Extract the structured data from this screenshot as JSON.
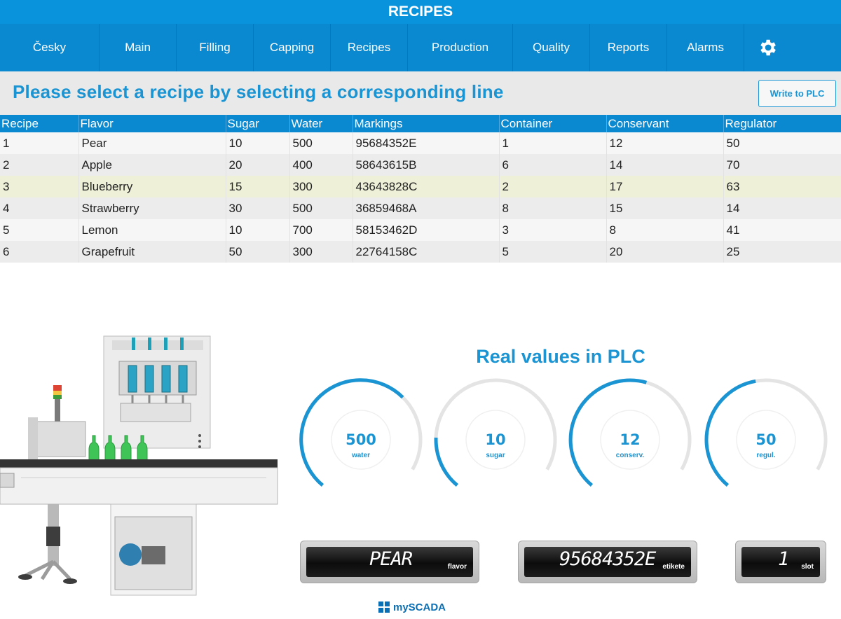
{
  "app": {
    "title": "RECIPES"
  },
  "nav": {
    "items": [
      "Česky",
      "Main",
      "Filling",
      "Capping",
      "Recipes",
      "Production",
      "Quality",
      "Reports",
      "Alarms"
    ],
    "settings_icon": "gear-icon"
  },
  "header": {
    "instruction": "Please select a recipe by selecting a corresponding line",
    "write_button": "Write to PLC"
  },
  "table": {
    "columns": [
      "Recipe",
      "Flavor",
      "Sugar",
      "Water",
      "Markings",
      "Container",
      "Conservant",
      "Regulator"
    ],
    "rows": [
      [
        "1",
        "Pear",
        "10",
        "500",
        "95684352E",
        "1",
        "12",
        "50"
      ],
      [
        "2",
        "Apple",
        "20",
        "400",
        "58643615B",
        "6",
        "14",
        "70"
      ],
      [
        "3",
        "Blueberry",
        "15",
        "300",
        "43643828C",
        "2",
        "17",
        "63"
      ],
      [
        "4",
        "Strawberry",
        "30",
        "500",
        "36859468A",
        "8",
        "15",
        "14"
      ],
      [
        "5",
        "Lemon",
        "10",
        "700",
        "58153462D",
        "3",
        "8",
        "41"
      ],
      [
        "6",
        "Grapefruit",
        "50",
        "300",
        "22764158C",
        "5",
        "20",
        "25"
      ]
    ],
    "selected_row": 3
  },
  "plc": {
    "title": "Real values in PLC",
    "gauges": [
      {
        "value": "500",
        "label": "water",
        "fill": 0.71
      },
      {
        "value": "10",
        "label": "sugar",
        "fill": 0.2
      },
      {
        "value": "12",
        "label": "conserv.",
        "fill": 0.6
      },
      {
        "value": "50",
        "label": "regul.",
        "fill": 0.5
      }
    ],
    "displays": [
      {
        "value": "PEAR",
        "label": "flavor"
      },
      {
        "value": "95684352E",
        "label": "etikete"
      },
      {
        "value": "1",
        "label": "slot"
      }
    ]
  },
  "footer": {
    "brand": "mySCADA"
  },
  "colors": {
    "accent": "#0a93dd",
    "nav": "#0a88d0",
    "heading": "#1a94d2",
    "selected_row": "#eef0d8",
    "bottle_green": "#3fc457"
  }
}
